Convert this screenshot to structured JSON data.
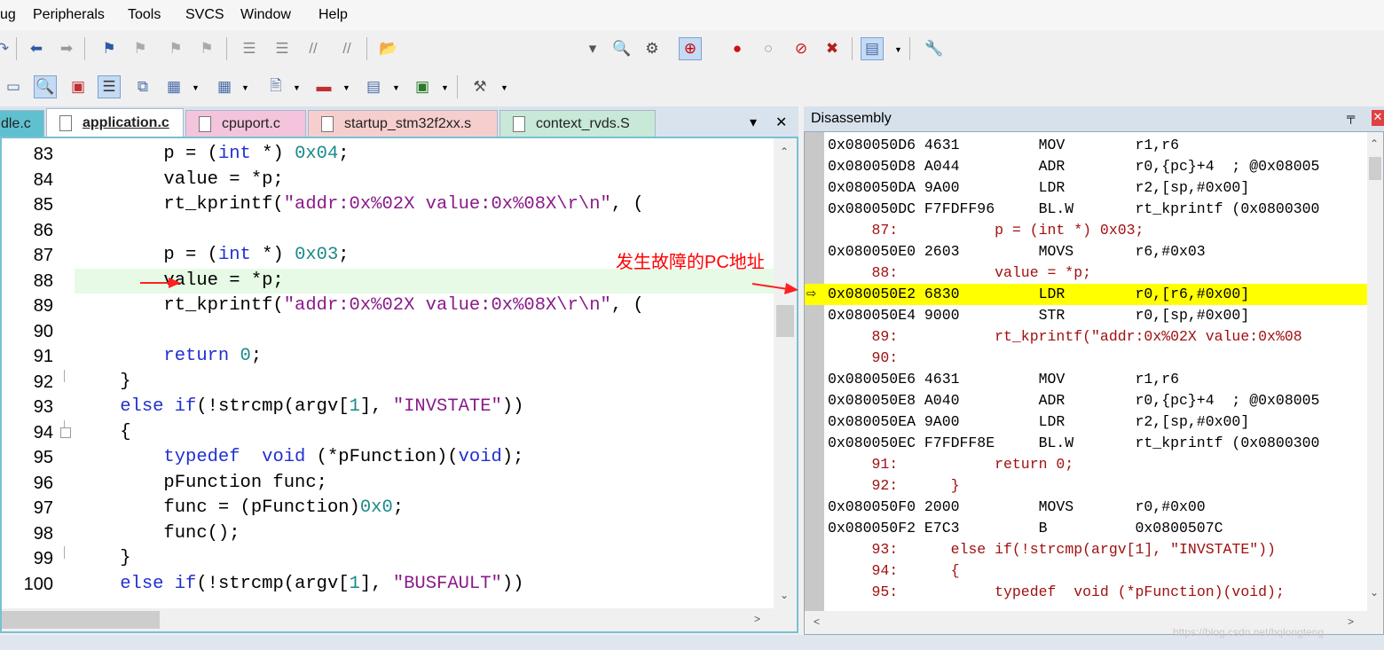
{
  "menu": [
    "ug",
    "Peripherals",
    "Tools",
    "SVCS",
    "Window",
    "Help"
  ],
  "tabs": [
    {
      "label": "dle.c"
    },
    {
      "label": "application.c"
    },
    {
      "label": "cpuport.c"
    },
    {
      "label": "startup_stm32f2xx.s"
    },
    {
      "label": "context_rvds.S"
    }
  ],
  "tab_controls": {
    "dropdown": "▾",
    "close": "✕"
  },
  "editor": {
    "current_line": 88,
    "lines": [
      {
        "n": "83",
        "t": "        p = (int *) 0x04;"
      },
      {
        "n": "84",
        "t": "        value = *p;"
      },
      {
        "n": "85",
        "t": "        rt_kprintf(\"addr:0x%02X value:0x%08X\\r\\n\", ("
      },
      {
        "n": "86",
        "t": ""
      },
      {
        "n": "87",
        "t": "        p = (int *) 0x03;"
      },
      {
        "n": "88",
        "t": "        value = *p;"
      },
      {
        "n": "89",
        "t": "        rt_kprintf(\"addr:0x%02X value:0x%08X\\r\\n\", ("
      },
      {
        "n": "90",
        "t": ""
      },
      {
        "n": "91",
        "t": "        return 0;"
      },
      {
        "n": "92",
        "t": "    }"
      },
      {
        "n": "93",
        "t": "    else if(!strcmp(argv[1], \"INVSTATE\"))"
      },
      {
        "n": "94",
        "t": "    {"
      },
      {
        "n": "95",
        "t": "        typedef  void (*pFunction)(void);"
      },
      {
        "n": "96",
        "t": "        pFunction func;"
      },
      {
        "n": "97",
        "t": "        func = (pFunction)0x0;"
      },
      {
        "n": "98",
        "t": "        func();"
      },
      {
        "n": "99",
        "t": "    }"
      },
      {
        "n": "100",
        "t": "    else if(!strcmp(argv[1], \"BUSFAULT\"))"
      }
    ]
  },
  "disassembly": {
    "title": "Disassembly",
    "pin": "ᵖ",
    "close": "x",
    "rows": [
      {
        "kind": "asm",
        "addr": "0x080050D6",
        "op": "4631",
        "mn": "MOV",
        "args": "r1,r6"
      },
      {
        "kind": "asm",
        "addr": "0x080050D8",
        "op": "A044",
        "mn": "ADR",
        "args": "r0,{pc}+4  ; @0x08005"
      },
      {
        "kind": "asm",
        "addr": "0x080050DA",
        "op": "9A00",
        "mn": "LDR",
        "args": "r2,[sp,#0x00]"
      },
      {
        "kind": "asm",
        "addr": "0x080050DC",
        "op": "F7FDFF96",
        "mn": "BL.W",
        "args": "rt_kprintf (0x0800300"
      },
      {
        "kind": "src",
        "ln": "87:",
        "code": "p = (int *) 0x03;",
        "indent": 2
      },
      {
        "kind": "asm",
        "addr": "0x080050E0",
        "op": "2603",
        "mn": "MOVS",
        "args": "r6,#0x03"
      },
      {
        "kind": "src",
        "ln": "88:",
        "code": "value = *p;",
        "indent": 2
      },
      {
        "kind": "asm",
        "addr": "0x080050E2",
        "op": "6830",
        "mn": "LDR",
        "args": "r0,[r6,#0x00]",
        "current": true
      },
      {
        "kind": "asm",
        "addr": "0x080050E4",
        "op": "9000",
        "mn": "STR",
        "args": "r0,[sp,#0x00]"
      },
      {
        "kind": "src",
        "ln": "89:",
        "code": "rt_kprintf(\"addr:0x%02X value:0x%08",
        "indent": 2
      },
      {
        "kind": "src",
        "ln": "90:",
        "code": "",
        "indent": 2
      },
      {
        "kind": "asm",
        "addr": "0x080050E6",
        "op": "4631",
        "mn": "MOV",
        "args": "r1,r6"
      },
      {
        "kind": "asm",
        "addr": "0x080050E8",
        "op": "A040",
        "mn": "ADR",
        "args": "r0,{pc}+4  ; @0x08005"
      },
      {
        "kind": "asm",
        "addr": "0x080050EA",
        "op": "9A00",
        "mn": "LDR",
        "args": "r2,[sp,#0x00]"
      },
      {
        "kind": "asm",
        "addr": "0x080050EC",
        "op": "F7FDFF8E",
        "mn": "BL.W",
        "args": "rt_kprintf (0x0800300"
      },
      {
        "kind": "src",
        "ln": "91:",
        "code": "return 0;",
        "indent": 2
      },
      {
        "kind": "src",
        "ln": "92:",
        "code": "}",
        "indent": 1
      },
      {
        "kind": "asm",
        "addr": "0x080050F0",
        "op": "2000",
        "mn": "MOVS",
        "args": "r0,#0x00"
      },
      {
        "kind": "asm",
        "addr": "0x080050F2",
        "op": "E7C3",
        "mn": "B",
        "args": "0x0800507C"
      },
      {
        "kind": "src",
        "ln": "93:",
        "code": "else if(!strcmp(argv[1], \"INVSTATE\"))",
        "indent": 1
      },
      {
        "kind": "src",
        "ln": "94:",
        "code": "{",
        "indent": 1
      },
      {
        "kind": "src",
        "ln": "95:",
        "code": "typedef  void (*pFunction)(void);",
        "indent": 2
      }
    ]
  },
  "annotation": "发生故障的PC地址",
  "watermark": "https://blog.csdn.net/hqlongteng",
  "colors": {
    "keyword": "#2030d0",
    "number": "#1a8a8a",
    "string": "#8a1a8a",
    "current_pc": "#ffff00",
    "exec_line": "#e6fae6",
    "annotation": "#ff0000"
  }
}
